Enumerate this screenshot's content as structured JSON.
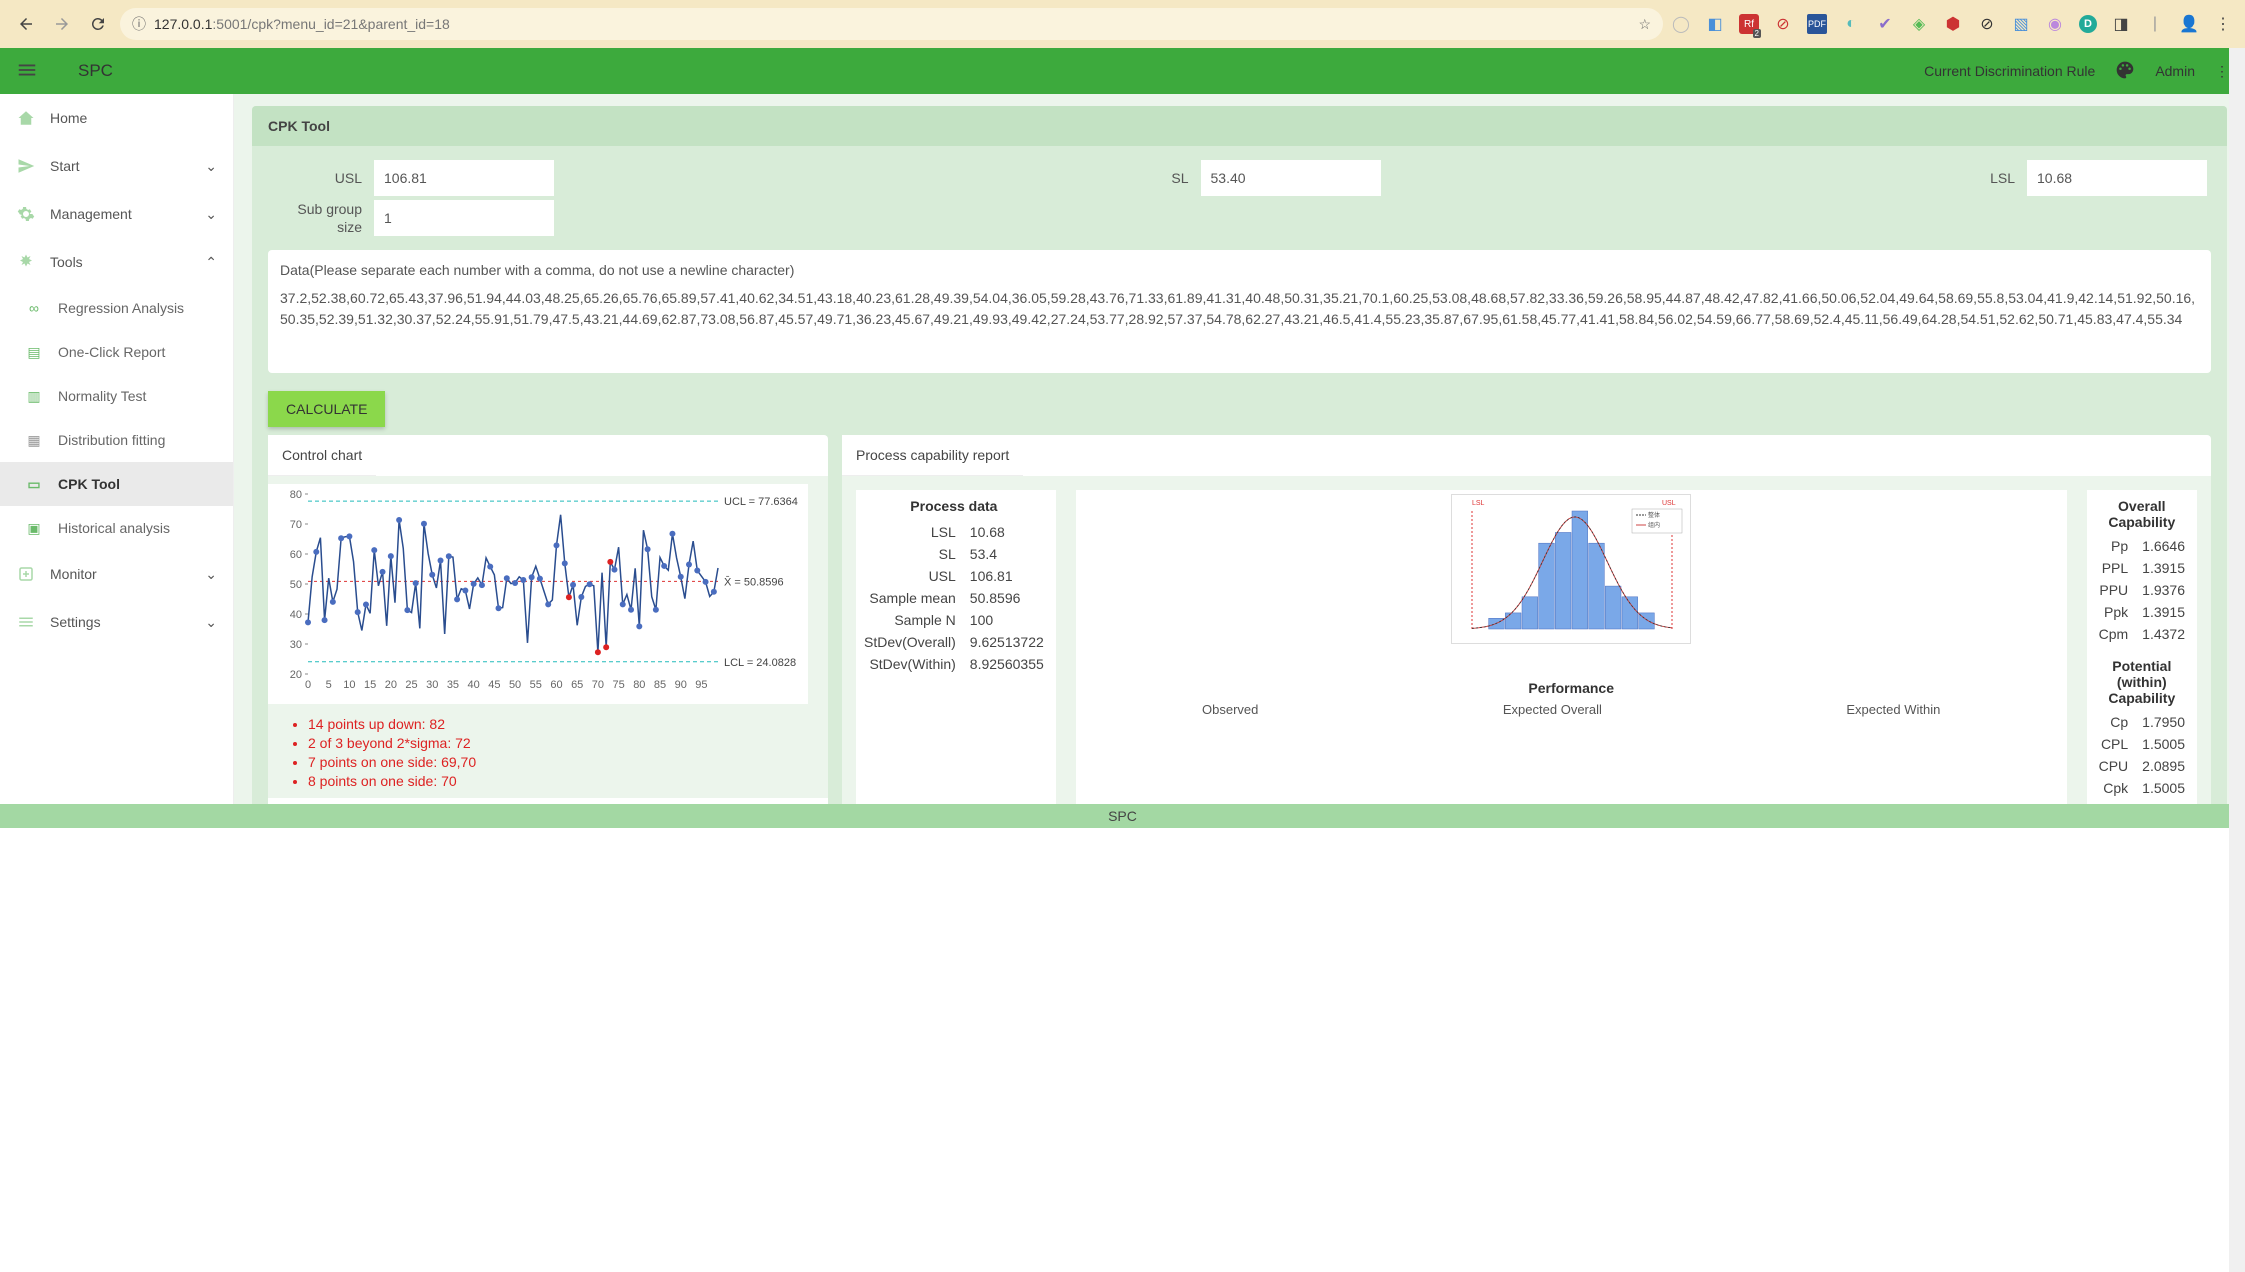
{
  "browser": {
    "url_host": "127.0.0.1",
    "url_path": ":5001/cpk?menu_id=21&parent_id=18"
  },
  "header": {
    "app_title": "SPC",
    "rule_label": "Current Discrimination Rule",
    "user": "Admin"
  },
  "sidebar": {
    "items": [
      {
        "label": "Home"
      },
      {
        "label": "Start"
      },
      {
        "label": "Management"
      },
      {
        "label": "Tools"
      },
      {
        "label": "Regression Analysis"
      },
      {
        "label": "One-Click Report"
      },
      {
        "label": "Normality Test"
      },
      {
        "label": "Distribution fitting"
      },
      {
        "label": "CPK Tool"
      },
      {
        "label": "Historical analysis"
      },
      {
        "label": "Monitor"
      },
      {
        "label": "Settings"
      }
    ]
  },
  "page": {
    "title": "CPK Tool",
    "usl_label": "USL",
    "usl_value": "106.81",
    "sl_label": "SL",
    "sl_value": "53.40",
    "lsl_label": "LSL",
    "lsl_value": "10.68",
    "subgroup_label": "Sub group size",
    "subgroup_value": "1",
    "data_label": "Data(Please separate each number with a comma, do not use a newline character)",
    "data_value": "37.2,52.38,60.72,65.43,37.96,51.94,44.03,48.25,65.26,65.76,65.89,57.41,40.62,34.51,43.18,40.23,61.28,49.39,54.04,36.05,59.28,43.76,71.33,61.89,41.31,40.48,50.31,35.21,70.1,60.25,53.08,48.68,57.82,33.36,59.26,58.95,44.87,48.42,47.82,41.66,50.06,52.04,49.64,58.69,55.8,53.04,41.9,42.14,51.92,50.16,50.35,52.39,51.32,30.37,52.24,55.91,51.79,47.5,43.21,44.69,62.87,73.08,56.87,45.57,49.71,36.23,45.67,49.21,49.93,49.42,27.24,53.77,28.92,57.37,54.78,62.27,43.21,46.5,41.4,55.23,35.87,67.95,61.58,45.77,41.41,58.84,56.02,54.59,66.77,58.69,52.4,45.11,56.49,64.28,54.51,52.62,50.71,45.83,47.4,55.34",
    "calc_button": "CALCULATE",
    "control_chart_title": "Control chart",
    "report_title": "Process capability report",
    "ucl_label": "UCL = 77.6364",
    "mean_label": "X̄  = 50.8596",
    "lcl_label": "LCL = 24.0828",
    "violations": [
      "14 points up down: 82",
      "2 of 3 beyond 2*sigma: 72",
      "7 points on one side: 69,70",
      "8 points on one side: 70"
    ],
    "process_data": {
      "title": "Process data",
      "rows": [
        [
          "LSL",
          "10.68"
        ],
        [
          "SL",
          "53.4"
        ],
        [
          "USL",
          "106.81"
        ],
        [
          "Sample mean",
          "50.8596"
        ],
        [
          "Sample N",
          "100"
        ],
        [
          "StDev(Overall)",
          "9.62513722"
        ],
        [
          "StDev(Within)",
          "8.92560355"
        ]
      ]
    },
    "overall_cap": {
      "title": "Overall Capability",
      "rows": [
        [
          "Pp",
          "1.6646"
        ],
        [
          "PPL",
          "1.3915"
        ],
        [
          "PPU",
          "1.9376"
        ],
        [
          "Ppk",
          "1.3915"
        ],
        [
          "Cpm",
          "1.4372"
        ]
      ]
    },
    "potential_cap": {
      "title": "Potential (within) Capability",
      "rows": [
        [
          "Cp",
          "1.7950"
        ],
        [
          "CPL",
          "1.5005"
        ],
        [
          "CPU",
          "2.0895"
        ],
        [
          "Cpk",
          "1.5005"
        ]
      ]
    },
    "performance": {
      "title": "Performance",
      "headers": [
        "Observed",
        "Expected Overall",
        "Expected Within"
      ]
    }
  },
  "footer": {
    "text": "SPC"
  },
  "chart_data": {
    "type": "line",
    "title": "Control chart",
    "xlabel": "",
    "ylabel": "",
    "x_ticks": [
      0,
      5,
      10,
      15,
      20,
      25,
      30,
      35,
      40,
      45,
      50,
      55,
      60,
      65,
      70,
      75,
      80,
      85,
      90,
      95
    ],
    "y_ticks": [
      20,
      30,
      40,
      50,
      60,
      70,
      80
    ],
    "ylim": [
      20,
      80
    ],
    "ucl": 77.6364,
    "center": 50.8596,
    "lcl": 24.0828,
    "series": [
      {
        "name": "value",
        "x": [
          0,
          1,
          2,
          3,
          4,
          5,
          6,
          7,
          8,
          9,
          10,
          11,
          12,
          13,
          14,
          15,
          16,
          17,
          18,
          19,
          20,
          21,
          22,
          23,
          24,
          25,
          26,
          27,
          28,
          29,
          30,
          31,
          32,
          33,
          34,
          35,
          36,
          37,
          38,
          39,
          40,
          41,
          42,
          43,
          44,
          45,
          46,
          47,
          48,
          49,
          50,
          51,
          52,
          53,
          54,
          55,
          56,
          57,
          58,
          59,
          60,
          61,
          62,
          63,
          64,
          65,
          66,
          67,
          68,
          69,
          70,
          71,
          72,
          73,
          74,
          75,
          76,
          77,
          78,
          79,
          80,
          81,
          82,
          83,
          84,
          85,
          86,
          87,
          88,
          89,
          90,
          91,
          92,
          93,
          94,
          95,
          96,
          97,
          98,
          99
        ],
        "values": [
          37.2,
          52.38,
          60.72,
          65.43,
          37.96,
          51.94,
          44.03,
          48.25,
          65.26,
          65.76,
          65.89,
          57.41,
          40.62,
          34.51,
          43.18,
          40.23,
          61.28,
          49.39,
          54.04,
          36.05,
          59.28,
          43.76,
          71.33,
          61.89,
          41.31,
          40.48,
          50.31,
          35.21,
          70.1,
          60.25,
          53.08,
          48.68,
          57.82,
          33.36,
          59.26,
          58.95,
          44.87,
          48.42,
          47.82,
          41.66,
          50.06,
          52.04,
          49.64,
          58.69,
          55.8,
          53.04,
          41.9,
          42.14,
          51.92,
          50.16,
          50.35,
          52.39,
          51.32,
          30.37,
          52.24,
          55.91,
          51.79,
          47.5,
          43.21,
          44.69,
          62.87,
          73.08,
          56.87,
          45.57,
          49.71,
          36.23,
          45.67,
          49.21,
          49.93,
          49.42,
          27.24,
          53.77,
          28.92,
          57.37,
          54.78,
          62.27,
          43.21,
          46.5,
          41.4,
          55.23,
          35.87,
          67.95,
          61.58,
          45.77,
          41.41,
          58.84,
          56.02,
          54.59,
          66.77,
          58.69,
          52.4,
          45.11,
          56.49,
          64.28,
          54.51,
          52.62,
          50.71,
          45.83,
          47.4,
          55.34
        ]
      }
    ],
    "violation_indices": [
      63,
      70,
      72,
      73
    ]
  }
}
